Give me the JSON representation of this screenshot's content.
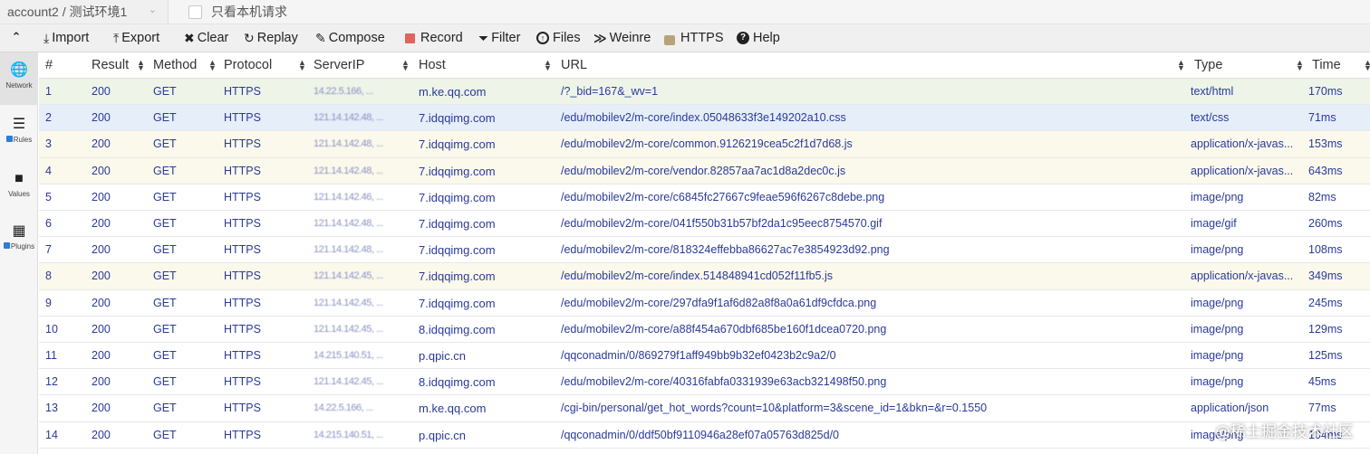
{
  "topbar": {
    "account_label": "account2 / 测试环境1",
    "local_only_label": "只看本机请求",
    "local_only_checked": false
  },
  "toolbar": {
    "collapse_icon": "chevron-up-icon",
    "buttons": [
      {
        "label": "Import",
        "icon": "import-icon"
      },
      {
        "label": "Export",
        "icon": "export-icon"
      },
      {
        "label": "Clear",
        "icon": "clear-icon"
      },
      {
        "label": "Replay",
        "icon": "replay-icon"
      },
      {
        "label": "Compose",
        "icon": "compose-icon"
      },
      {
        "label": "Record",
        "icon": "record-icon",
        "color": "#e0645c"
      },
      {
        "label": "Filter",
        "icon": "filter-icon"
      },
      {
        "label": "Files",
        "icon": "files-icon"
      },
      {
        "label": "Weinre",
        "icon": "terminal-icon"
      },
      {
        "label": "HTTPS",
        "icon": "lock-icon",
        "color": "#b8a27a"
      },
      {
        "label": "Help",
        "icon": "help-icon"
      }
    ]
  },
  "sidebar": {
    "items": [
      {
        "label": "Network",
        "icon": "globe-icon",
        "active": true,
        "checkbox": false
      },
      {
        "label": "Rules",
        "icon": "list-icon",
        "active": false,
        "checkbox": true
      },
      {
        "label": "Values",
        "icon": "folder-icon",
        "active": false,
        "checkbox": false
      },
      {
        "label": "Plugins",
        "icon": "table-icon",
        "active": false,
        "checkbox": true
      }
    ]
  },
  "table": {
    "columns": [
      "#",
      "Result",
      "Method",
      "Protocol",
      "ServerIP",
      "Host",
      "URL",
      "Type",
      "Time"
    ],
    "rows": [
      {
        "num": "1",
        "result": "200",
        "method": "GET",
        "protocol": "HTTPS",
        "ip": "14.22.5.166, ...",
        "host": "m.ke.qq.com",
        "url": "/?_bid=167&_wv=1",
        "type": "text/html",
        "time": "170ms",
        "color": "green"
      },
      {
        "num": "2",
        "result": "200",
        "method": "GET",
        "protocol": "HTTPS",
        "ip": "121.14.142.48, ...",
        "host": "7.idqqimg.com",
        "url": "/edu/mobilev2/m-core/index.05048633f3e149202a10.css",
        "type": "text/css",
        "time": "71ms",
        "color": "blue"
      },
      {
        "num": "3",
        "result": "200",
        "method": "GET",
        "protocol": "HTTPS",
        "ip": "121.14.142.48, ...",
        "host": "7.idqqimg.com",
        "url": "/edu/mobilev2/m-core/common.9126219cea5c2f1d7d68.js",
        "type": "application/x-javas...",
        "time": "153ms",
        "color": "yellow"
      },
      {
        "num": "4",
        "result": "200",
        "method": "GET",
        "protocol": "HTTPS",
        "ip": "121.14.142.48, ...",
        "host": "7.idqqimg.com",
        "url": "/edu/mobilev2/m-core/vendor.82857aa7ac1d8a2dec0c.js",
        "type": "application/x-javas...",
        "time": "643ms",
        "color": "yellow"
      },
      {
        "num": "5",
        "result": "200",
        "method": "GET",
        "protocol": "HTTPS",
        "ip": "121.14.142.46, ...",
        "host": "7.idqqimg.com",
        "url": "/edu/mobilev2/m-core/c6845fc27667c9feae596f6267c8debe.png",
        "type": "image/png",
        "time": "82ms",
        "color": "white"
      },
      {
        "num": "6",
        "result": "200",
        "method": "GET",
        "protocol": "HTTPS",
        "ip": "121.14.142.48, ...",
        "host": "7.idqqimg.com",
        "url": "/edu/mobilev2/m-core/041f550b31b57bf2da1c95eec8754570.gif",
        "type": "image/gif",
        "time": "260ms",
        "color": "white"
      },
      {
        "num": "7",
        "result": "200",
        "method": "GET",
        "protocol": "HTTPS",
        "ip": "121.14.142.48, ...",
        "host": "7.idqqimg.com",
        "url": "/edu/mobilev2/m-core/818324effebba86627ac7e3854923d92.png",
        "type": "image/png",
        "time": "108ms",
        "color": "white"
      },
      {
        "num": "8",
        "result": "200",
        "method": "GET",
        "protocol": "HTTPS",
        "ip": "121.14.142.45, ...",
        "host": "7.idqqimg.com",
        "url": "/edu/mobilev2/m-core/index.514848941cd052f11fb5.js",
        "type": "application/x-javas...",
        "time": "349ms",
        "color": "yellow"
      },
      {
        "num": "9",
        "result": "200",
        "method": "GET",
        "protocol": "HTTPS",
        "ip": "121.14.142.45, ...",
        "host": "7.idqqimg.com",
        "url": "/edu/mobilev2/m-core/297dfa9f1af6d82a8f8a0a61df9cfdca.png",
        "type": "image/png",
        "time": "245ms",
        "color": "white"
      },
      {
        "num": "10",
        "result": "200",
        "method": "GET",
        "protocol": "HTTPS",
        "ip": "121.14.142.45, ...",
        "host": "8.idqqimg.com",
        "url": "/edu/mobilev2/m-core/a88f454a670dbf685be160f1dcea0720.png",
        "type": "image/png",
        "time": "129ms",
        "color": "white"
      },
      {
        "num": "11",
        "result": "200",
        "method": "GET",
        "protocol": "HTTPS",
        "ip": "14.215.140.51, ...",
        "host": "p.qpic.cn",
        "url": "/qqconadmin/0/869279f1aff949bb9b32ef0423b2c9a2/0",
        "type": "image/png",
        "time": "125ms",
        "color": "white"
      },
      {
        "num": "12",
        "result": "200",
        "method": "GET",
        "protocol": "HTTPS",
        "ip": "121.14.142.45, ...",
        "host": "8.idqqimg.com",
        "url": "/edu/mobilev2/m-core/40316fabfa0331939e63acb321498f50.png",
        "type": "image/png",
        "time": "45ms",
        "color": "white"
      },
      {
        "num": "13",
        "result": "200",
        "method": "GET",
        "protocol": "HTTPS",
        "ip": "14.22.5.166, ...",
        "host": "m.ke.qq.com",
        "url": "/cgi-bin/personal/get_hot_words?count=10&platform=3&scene_id=1&bkn=&r=0.1550",
        "type": "application/json",
        "time": "77ms",
        "color": "white"
      },
      {
        "num": "14",
        "result": "200",
        "method": "GET",
        "protocol": "HTTPS",
        "ip": "14.215.140.51, ...",
        "host": "p.qpic.cn",
        "url": "/qqconadmin/0/ddf50bf9110946a28ef07a05763d825d/0",
        "type": "image/png",
        "time": "104ms",
        "color": "white"
      }
    ]
  },
  "watermark": "@稀土掘金技术社区"
}
